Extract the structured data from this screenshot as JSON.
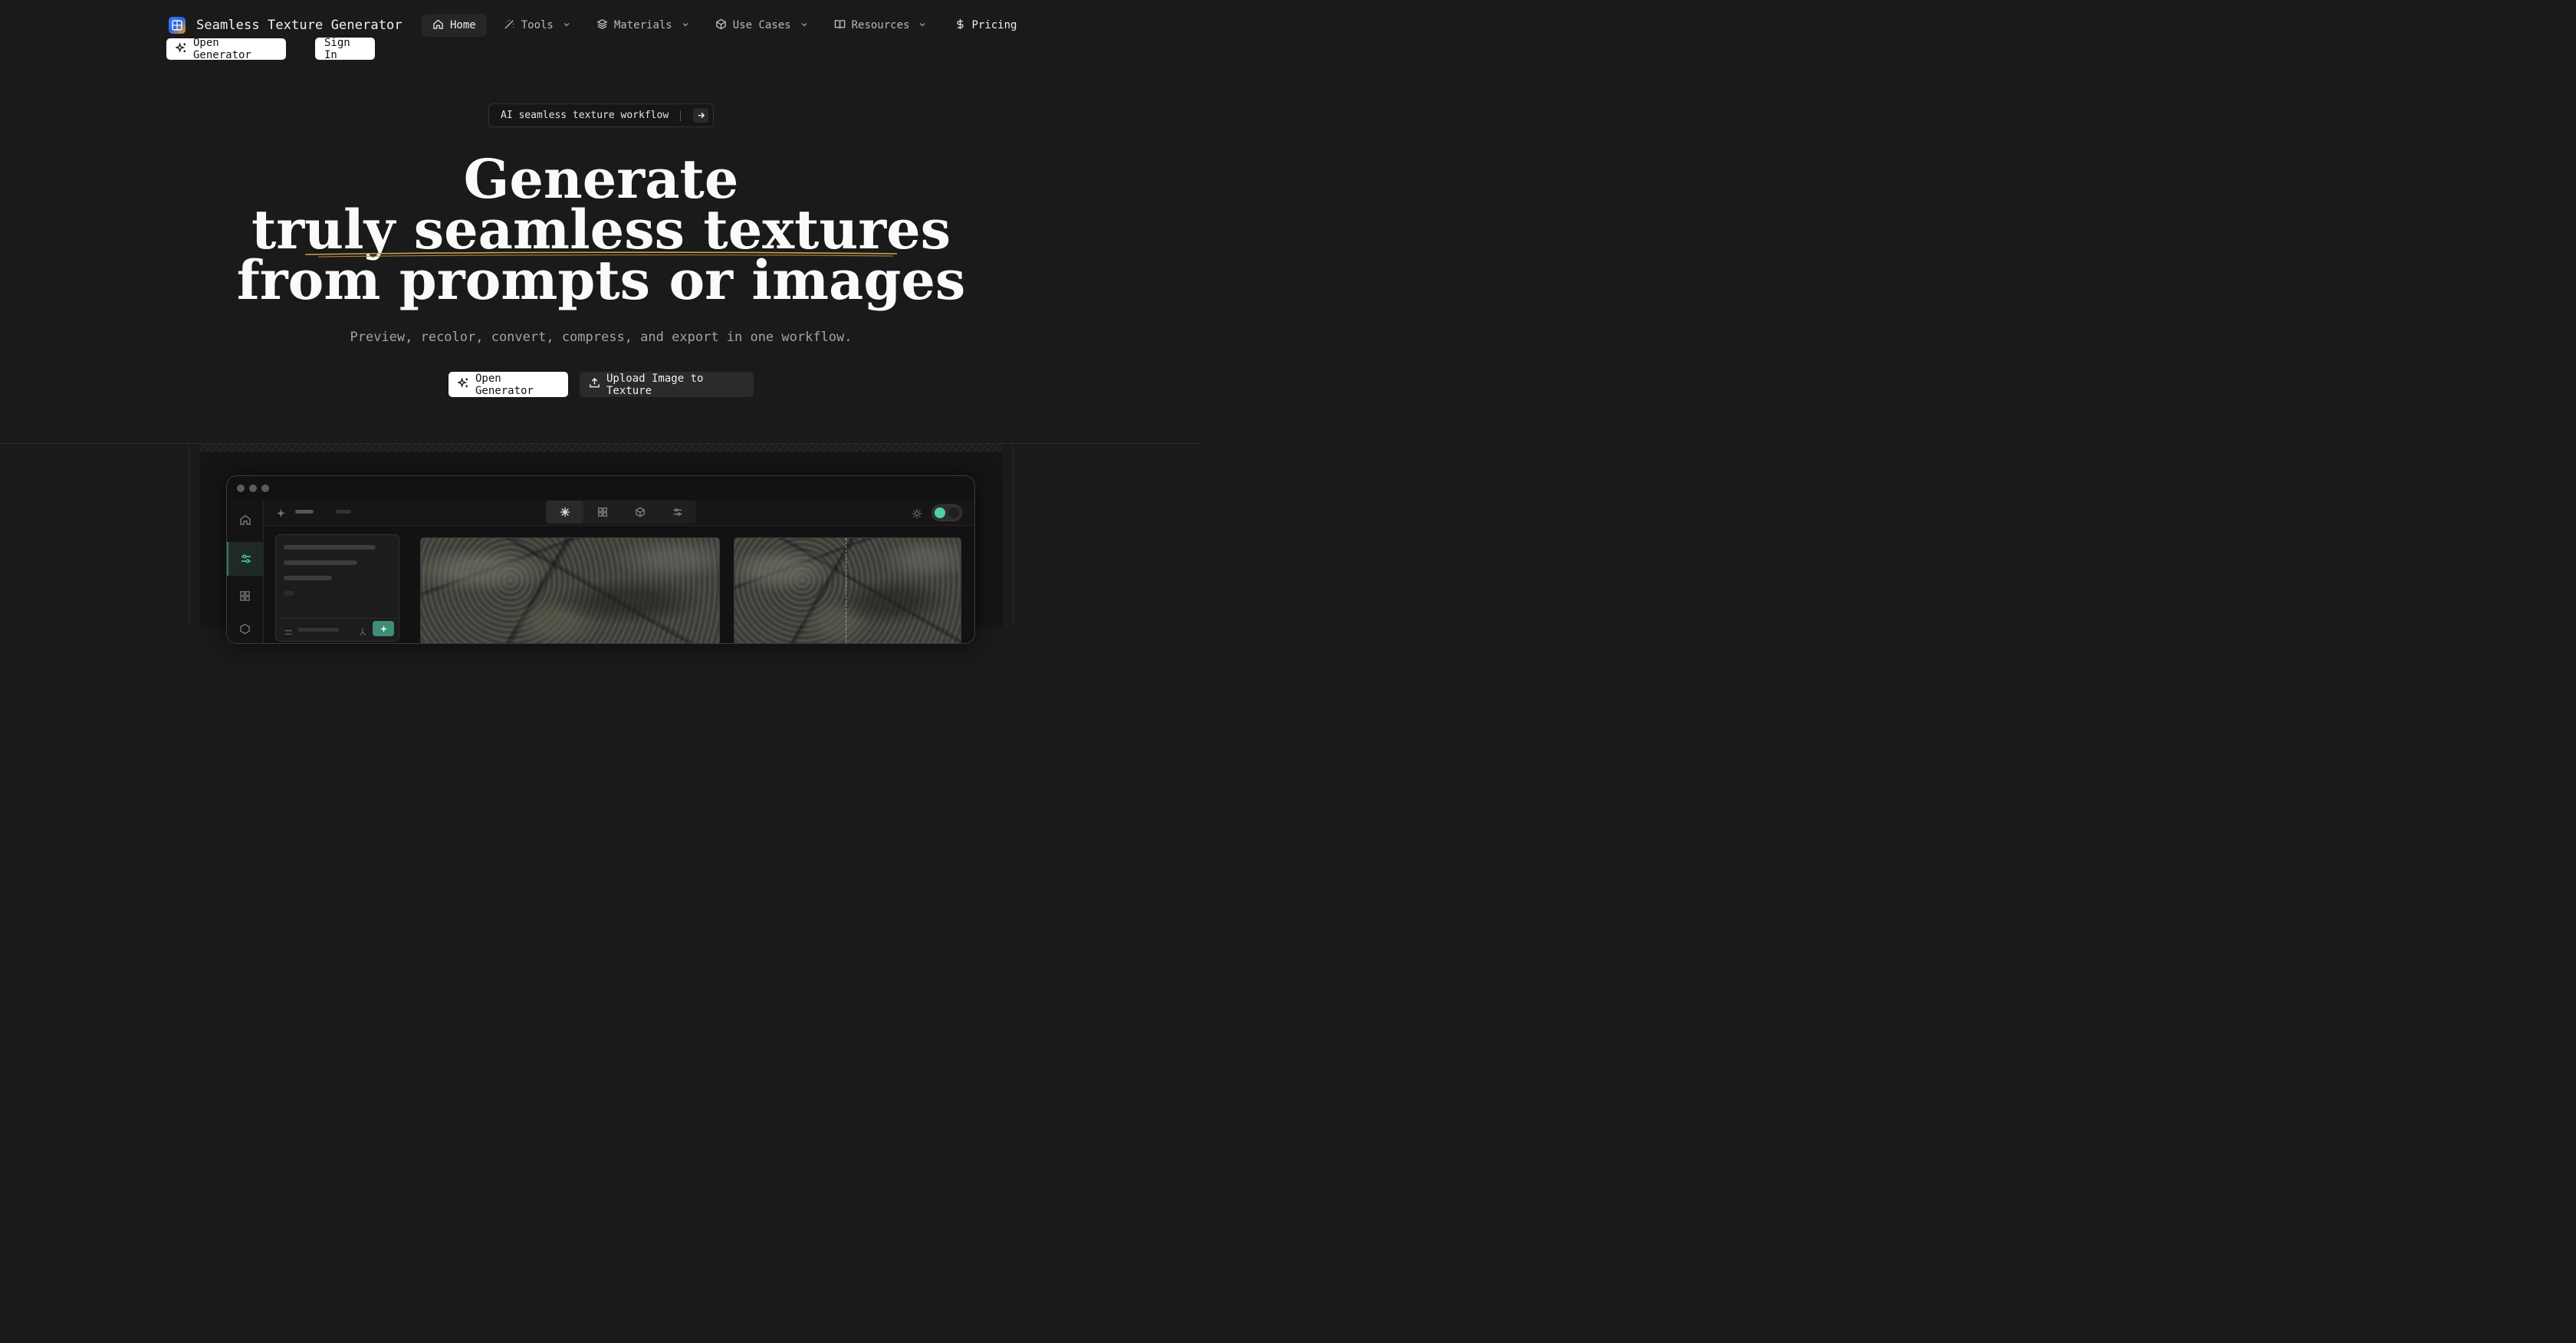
{
  "brand": {
    "title": "Seamless Texture Generator",
    "logo_icon": "grid-logo-icon"
  },
  "nav": {
    "items": [
      {
        "label": "Home",
        "icon": "home-icon",
        "active": true,
        "has_dropdown": false
      },
      {
        "label": "Tools",
        "icon": "wand-icon",
        "active": false,
        "has_dropdown": true
      },
      {
        "label": "Materials",
        "icon": "layers-icon",
        "active": false,
        "has_dropdown": true
      },
      {
        "label": "Use Cases",
        "icon": "cube-icon",
        "active": false,
        "has_dropdown": true
      },
      {
        "label": "Resources",
        "icon": "book-icon",
        "active": false,
        "has_dropdown": true
      },
      {
        "label": "Pricing",
        "icon": "dollar-icon",
        "active": false,
        "has_dropdown": false
      }
    ]
  },
  "header": {
    "open_generator": "Open Generator",
    "sign_in": "Sign In"
  },
  "hero": {
    "badge": "AI seamless texture workflow",
    "headline_line1": "Generate",
    "headline_line2": "truly seamless textures",
    "headline_line3": "from prompts or images",
    "subtitle": "Preview, recolor, convert, compress, and export in one workflow.",
    "cta_primary": "Open Generator",
    "cta_secondary": "Upload Image to Texture"
  },
  "colors": {
    "background": "#1a1a1a",
    "accent_green": "#4fd1a5",
    "underline_gold": "#c9a04a",
    "primary_button": "#ffffff"
  }
}
